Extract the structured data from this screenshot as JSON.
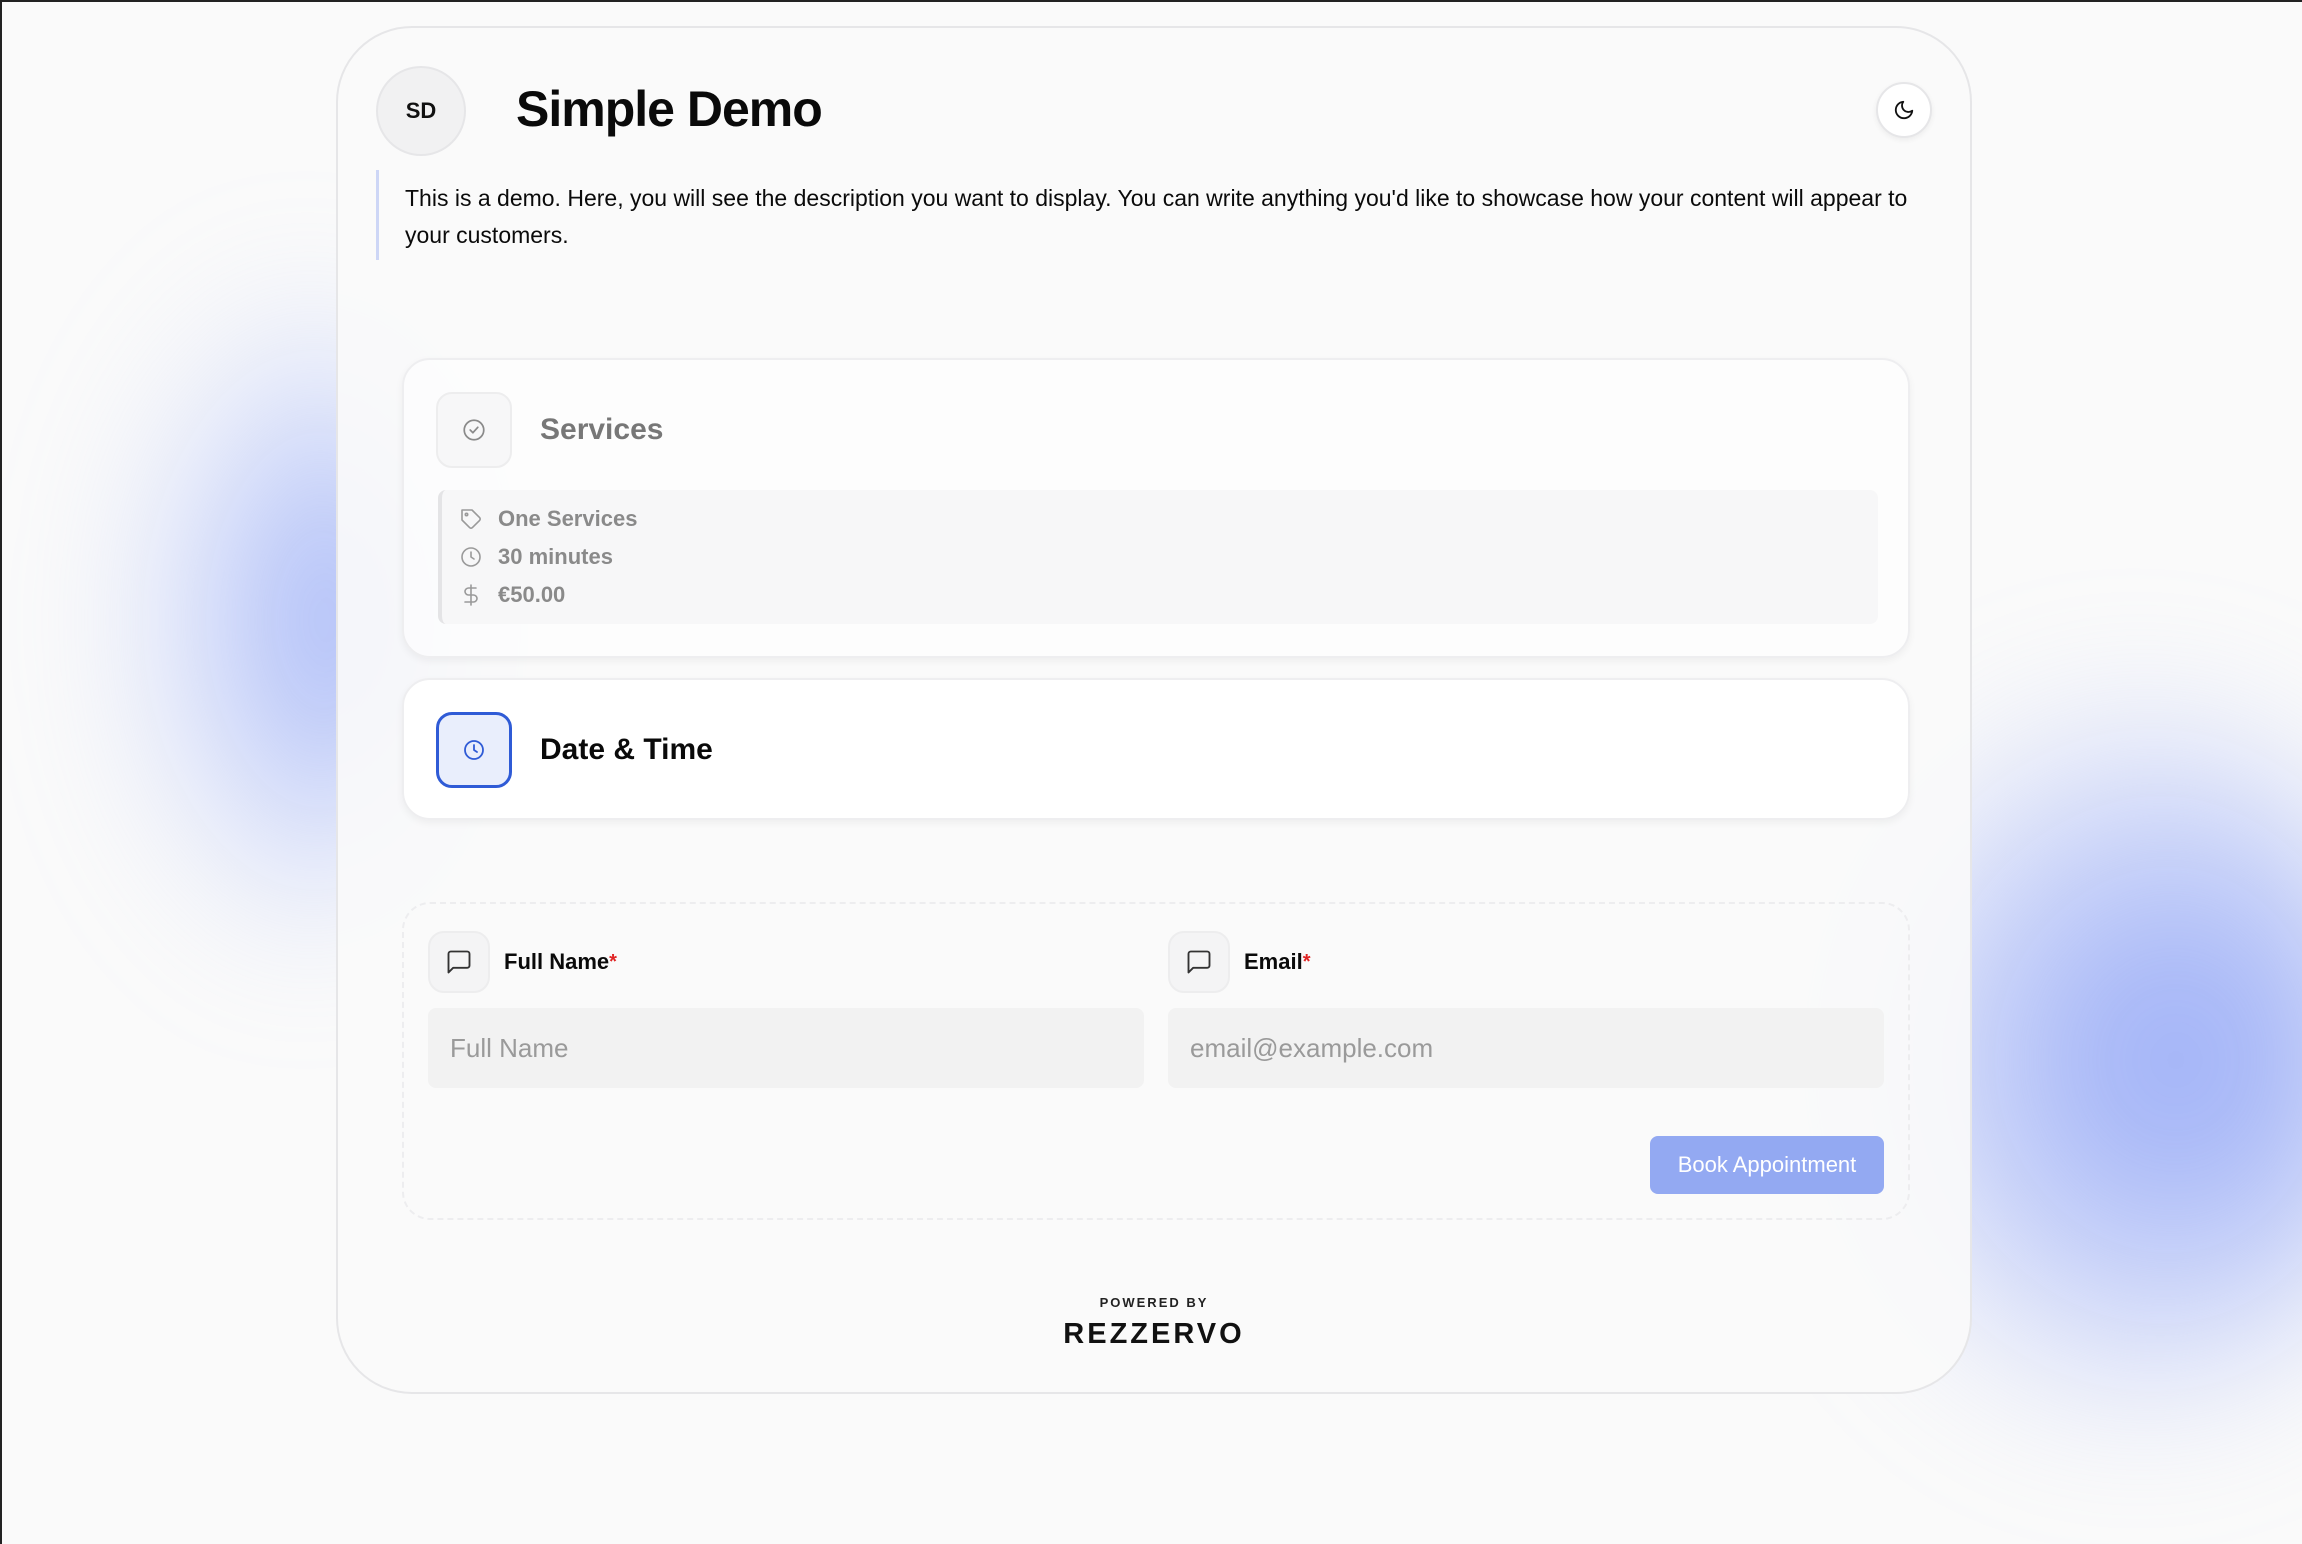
{
  "header": {
    "avatar_initials": "SD",
    "title": "Simple Demo",
    "theme_toggle_icon": "moon-icon"
  },
  "description": "This is a demo. Here, you will see the description you want to display. You can write anything you'd like to showcase how your content will appear to your customers.",
  "services": {
    "title": "Services",
    "icon": "check-circle-icon",
    "details": {
      "name": "One Services",
      "name_icon": "tag-icon",
      "duration": "30 minutes",
      "duration_icon": "clock-icon",
      "price": "€50.00",
      "price_icon": "dollar-icon"
    }
  },
  "datetime": {
    "title": "Date & Time",
    "icon": "clock-icon"
  },
  "form": {
    "full_name": {
      "label": "Full Name",
      "required_mark": "*",
      "placeholder": "Full Name",
      "value": "",
      "icon": "message-square-icon"
    },
    "email": {
      "label": "Email",
      "required_mark": "*",
      "placeholder": "email@example.com",
      "value": "",
      "icon": "message-square-icon"
    },
    "submit_label": "Book Appointment"
  },
  "footer": {
    "powered_by": "POWERED BY",
    "brand": "REZZERVO"
  },
  "colors": {
    "accent": "#2f5bd6",
    "button": "#93a9f2",
    "required": "#e02424",
    "background": "#fafafa"
  }
}
